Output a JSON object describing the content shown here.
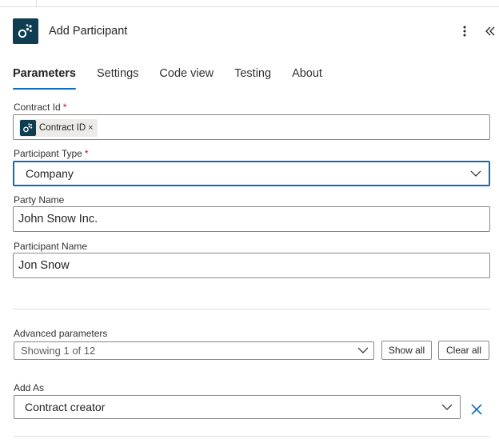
{
  "header": {
    "title": "Add Participant",
    "more_icon": "more-vertical-icon",
    "collapse_icon": "double-chevron-left-icon",
    "app_icon": "connector-logo-icon"
  },
  "tabs": [
    {
      "label": "Parameters",
      "active": true
    },
    {
      "label": "Settings",
      "active": false
    },
    {
      "label": "Code view",
      "active": false
    },
    {
      "label": "Testing",
      "active": false
    },
    {
      "label": "About",
      "active": false
    }
  ],
  "fields": {
    "contract_id": {
      "label": "Contract Id",
      "required_mark": "*",
      "token_label": "Contract ID",
      "token_remove": "×"
    },
    "participant_type": {
      "label": "Participant Type",
      "required_mark": "*",
      "value": "Company"
    },
    "party_name": {
      "label": "Party Name",
      "value": "John Snow Inc."
    },
    "participant_name": {
      "label": "Participant Name",
      "value": "Jon Snow"
    }
  },
  "advanced": {
    "label": "Advanced parameters",
    "value": "Showing 1 of 12",
    "show_all": "Show all",
    "clear_all": "Clear all"
  },
  "add_as": {
    "label": "Add As",
    "value": "Contract creator"
  },
  "colors": {
    "accent": "#0f6cbd",
    "brand": "#0f3d52",
    "required": "#c50f1f"
  }
}
